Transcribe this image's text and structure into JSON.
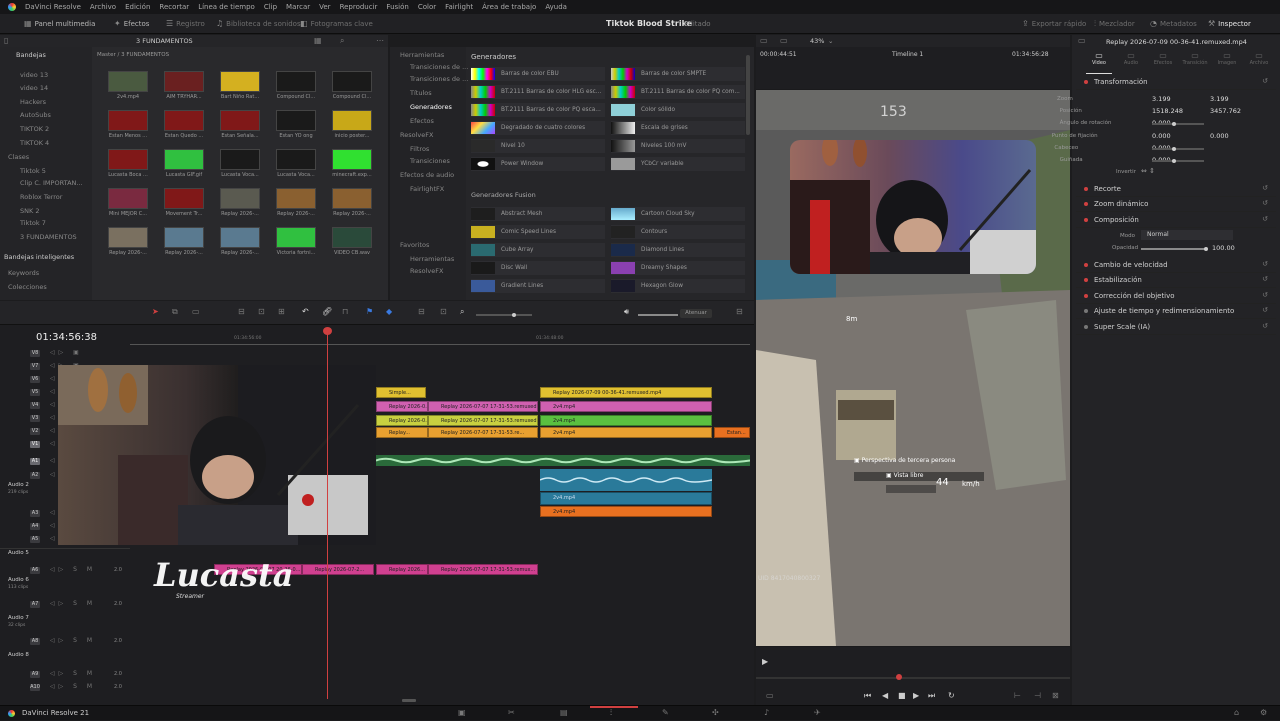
{
  "menu": [
    "DaVinci Resolve",
    "Archivo",
    "Edición",
    "Recortar",
    "Línea de tiempo",
    "Clip",
    "Marcar",
    "Ver",
    "Reproducir",
    "Fusión",
    "Color",
    "Fairlight",
    "Área de trabajo",
    "Ayuda"
  ],
  "toolbar": {
    "media_pool": "Panel multimedia",
    "effects": "Efectos",
    "edit_index": "Registro",
    "sound_library": "Biblioteca de sonidos",
    "stills": "Fotogramas clave",
    "project_title": "Tiktok Blood Strike",
    "project_status": "Editado",
    "quick_export": "Exportar rápido",
    "mixer": "Mezclador",
    "metadata": "Metadatos",
    "inspector": "Inspector"
  },
  "media_pool": {
    "header_label": "Bandejas",
    "breadcrumb": "Master / 3 FUNDAMENTOS",
    "path_label": "3 FUNDAMENTOS",
    "bins": [
      "video 13",
      "video 14",
      "Hackers",
      "AutoSubs",
      "TIKTOK 2",
      "TIKTOK 4",
      "Clases",
      "Tiktok 5",
      "Clip C. IMPORTAN...",
      "Roblox Terror",
      "SNK 2",
      "Tiktok 7",
      "3 FUNDAMENTOS"
    ],
    "smart_bins_header": "Bandejas inteligentes",
    "smart_bins": [
      "Keywords",
      "Colecciones"
    ],
    "clips": [
      {
        "name": "2v4.mp4",
        "color": "#4a5a40"
      },
      {
        "name": "AIM TRYHAR...",
        "color": "#6a2020"
      },
      {
        "name": "Bart Niño Rat...",
        "color": "#d4b020"
      },
      {
        "name": "Compound Cl...",
        "color": "#1a1a1a"
      },
      {
        "name": "Compound Cl...",
        "color": "#1a1a1a"
      },
      {
        "name": "Estan Menos ...",
        "color": "#801818"
      },
      {
        "name": "Estan Quedo ...",
        "color": "#801818"
      },
      {
        "name": "Estan Señala...",
        "color": "#801818"
      },
      {
        "name": "Estan YO ong",
        "color": "#1a1a1a"
      },
      {
        "name": "inicio poster...",
        "color": "#c8a818"
      },
      {
        "name": "Lucasta Boca ...",
        "color": "#801818"
      },
      {
        "name": "Lucasta GIF.gif",
        "color": "#30c040"
      },
      {
        "name": "Lucasta Voca...",
        "color": "#1a1a1a"
      },
      {
        "name": "Lucasta Voca...",
        "color": "#1a1a1a"
      },
      {
        "name": "minecraft.exp...",
        "color": "#30e030"
      },
      {
        "name": "Mini MEJOR C...",
        "color": "#7a2a40"
      },
      {
        "name": "Movement Tr...",
        "color": "#801818"
      },
      {
        "name": "Replay 2026-...",
        "color": "#5a5a50"
      },
      {
        "name": "Replay 2026-...",
        "color": "#8a6030"
      },
      {
        "name": "Replay 2026-...",
        "color": "#8a6030"
      },
      {
        "name": "Replay 2026-...",
        "color": "#7a7060"
      },
      {
        "name": "Replay 2026-...",
        "color": "#5a7a90"
      },
      {
        "name": "Replay 2026-...",
        "color": "#5a7a90"
      },
      {
        "name": "Victoria fortni...",
        "color": "#30c040"
      },
      {
        "name": "VIDEO CB.wav",
        "color": "#2a4a3a"
      }
    ]
  },
  "effects": {
    "tree": [
      "Herramientas",
      "Transiciones de ...",
      "Transiciones de ...",
      "Títulos",
      "Generadores",
      "Efectos",
      "ResolveFX",
      "Filtros",
      "Transiciones",
      "Efectos de audio",
      "FairlightFX",
      "Favoritos",
      "Herramientas",
      "ResolveFX"
    ],
    "generators_header": "Generadores",
    "generators": [
      {
        "name": "Barras de color EBU",
        "sw": "linear-gradient(90deg,#fff,#ff0,#0ff,#0f0,#f0f,#f00,#00f)"
      },
      {
        "name": "Barras de color SMPTE",
        "sw": "linear-gradient(90deg,#ccc,#cc0,#0cc,#0c0,#c0c,#c00,#00c)"
      },
      {
        "name": "BT.2111 Barras de color HLG esc...",
        "sw": "linear-gradient(90deg,#888,#cc0,#0cc,#0c0,#c0c,#c00)"
      },
      {
        "name": "BT.2111 Barras de color PQ com...",
        "sw": "linear-gradient(90deg,#888,#cc0,#0cc,#0c0,#c0c,#c00)"
      },
      {
        "name": "BT.2111 Barras de color PQ esca...",
        "sw": "linear-gradient(90deg,#888,#cc0,#0cc,#0c0,#c0c,#c00)"
      },
      {
        "name": "Color sólido",
        "sw": "#8fd0d8"
      },
      {
        "name": "Degradado de cuatro colores",
        "sw": "linear-gradient(135deg,#f44,#fd4,#4af,#a4f)"
      },
      {
        "name": "Escala de grises",
        "sw": "linear-gradient(90deg,#111,#eee)"
      },
      {
        "name": "Nivel 10",
        "sw": "#2a2a2a"
      },
      {
        "name": "Niveles 100 mV",
        "sw": "linear-gradient(90deg,#111,#999)"
      },
      {
        "name": "Power Window",
        "sw": "radial-gradient(#fff 30%,#111 35%)"
      },
      {
        "name": "YCbCr variable",
        "sw": "#9a9a9a"
      }
    ],
    "fusion_header": "Generadores Fusion",
    "fusion": [
      {
        "name": "Abstract Mesh",
        "sw": "#1e1e1e"
      },
      {
        "name": "Cartoon Cloud Sky",
        "sw": "linear-gradient(#6ac,#aef)"
      },
      {
        "name": "Comic Speed Lines",
        "sw": "#c8b020"
      },
      {
        "name": "Contours",
        "sw": "#222"
      },
      {
        "name": "Cube Array",
        "sw": "#2a6a70"
      },
      {
        "name": "Diamond Lines",
        "sw": "#1a2a4a"
      },
      {
        "name": "Disc Wall",
        "sw": "#1a1a1a"
      },
      {
        "name": "Dreamy Shapes",
        "sw": "#8a40b0"
      },
      {
        "name": "Gradient Lines",
        "sw": "#3a5a9a"
      },
      {
        "name": "Hexagon Glow",
        "sw": "#1a1a2a"
      }
    ]
  },
  "timeline": {
    "timecode": "01:34:56:38",
    "ruler": [
      "01:34:56:00",
      "01:34:48:00"
    ],
    "attenuate": "Atenuar",
    "video_tracks": [
      "V8",
      "V7",
      "V6",
      "V5",
      "V4",
      "V3",
      "V2",
      "V1"
    ],
    "audio_tracks": [
      "A1",
      "A2",
      "A3",
      "A4",
      "A5",
      "A6",
      "A7",
      "A8",
      "A9",
      "A10"
    ],
    "audio_names": [
      {
        "name": "Audio 2",
        "sub": "219 clips"
      },
      {
        "name": "Audio 5",
        "sub": ""
      },
      {
        "name": "Audio 6",
        "sub": "113 clips"
      },
      {
        "name": "Audio 7",
        "sub": "32 clips"
      },
      {
        "name": "Audio 8",
        "sub": ""
      }
    ],
    "volume": "2.0",
    "clips": [
      {
        "label": "Simple...",
        "color": "#e0c030"
      },
      {
        "label": "Replay 2026-07-09 00-36-41.remuxed.mp4",
        "color": "#e0c030"
      },
      {
        "label": "Replay 2026-0...",
        "color": "#d060b0"
      },
      {
        "label": "Replay 2026-07-07 17-31-53.remuxed.m...",
        "color": "#d060b0"
      },
      {
        "label": "2v4.mp4",
        "color": "#d060b0"
      },
      {
        "label": "Replay 2026-0...",
        "color": "#c8d040"
      },
      {
        "label": "Replay 2026-07-07 17-31-53.remuxed...",
        "color": "#c8d040"
      },
      {
        "label": "2v4.mp4",
        "color": "#5ac040"
      },
      {
        "label": "Replay...",
        "color": "#e8a030"
      },
      {
        "label": "Replay 2026-07-07 17-31-53.re...",
        "color": "#e8a030"
      },
      {
        "label": "2v4.mp4",
        "color": "#e8a030"
      },
      {
        "label": "Estan...",
        "color": "#e87020"
      },
      {
        "label": "2v4.mp4",
        "color": "#2a7a9a"
      },
      {
        "label": "2v4.mp4",
        "color": "#e87020"
      },
      {
        "label": "Replay 2026-07-07 20-26-0...",
        "color": "#d04090"
      },
      {
        "label": "Replay 2026-07-2...",
        "color": "#d04090"
      },
      {
        "label": "Replay 2026...",
        "color": "#d04090"
      },
      {
        "label": "Replay 2026-07-07 17-31-53.remux...",
        "color": "#d04090"
      }
    ],
    "watermark": "Lucasta",
    "watermark_sub": "Streamer"
  },
  "viewer": {
    "zoom": "43%",
    "timecode_left": "00:00:44:51",
    "timeline_name": "Timeline 1",
    "timecode_right": "01:34:56:28",
    "hud_distance": "8m",
    "hud_view": "Perspectiva de tercera persona",
    "hud_view2": "Vista libre",
    "hud_speed": "44",
    "hud_speed_unit": "km/h",
    "hud_id": "UID 8417040800327",
    "hud_top": "153"
  },
  "inspector": {
    "clip_name": "Replay 2026-07-09 00-36-41.remuxed.mp4",
    "tabs": [
      "Video",
      "Audio",
      "Efectos",
      "Transición",
      "Imagen",
      "Archivo"
    ],
    "sections": [
      {
        "label": "Transformación"
      },
      {
        "label": "Recorte"
      },
      {
        "label": "Zoom dinámico"
      },
      {
        "label": "Composición"
      },
      {
        "label": "Cambio de velocidad"
      },
      {
        "label": "Estabilización"
      },
      {
        "label": "Corrección del objetivo"
      },
      {
        "label": "Ajuste de tiempo y redimensionamiento"
      },
      {
        "label": "Super Scale (IA)"
      }
    ],
    "transform": {
      "zoom_label": "Zoom",
      "zoom_x": "3.199",
      "zoom_y": "3.199",
      "pos_label": "Posición",
      "pos_x": "1518.248",
      "pos_y": "3457.762",
      "rot_label": "Ángulo de rotación",
      "rot": "0.000",
      "anchor_label": "Punto de fijación",
      "anchor_x": "0.000",
      "anchor_y": "0.000",
      "pitch_label": "Cabeceo",
      "pitch": "0.000",
      "yaw_label": "Guiñada",
      "yaw": "0.000",
      "flip_label": "Invertir"
    },
    "composite": {
      "mode_label": "Modo",
      "mode": "Normal",
      "opacity_label": "Opacidad",
      "opacity": "100.00"
    }
  },
  "bottom": {
    "app": "DaVinci Resolve 21"
  }
}
